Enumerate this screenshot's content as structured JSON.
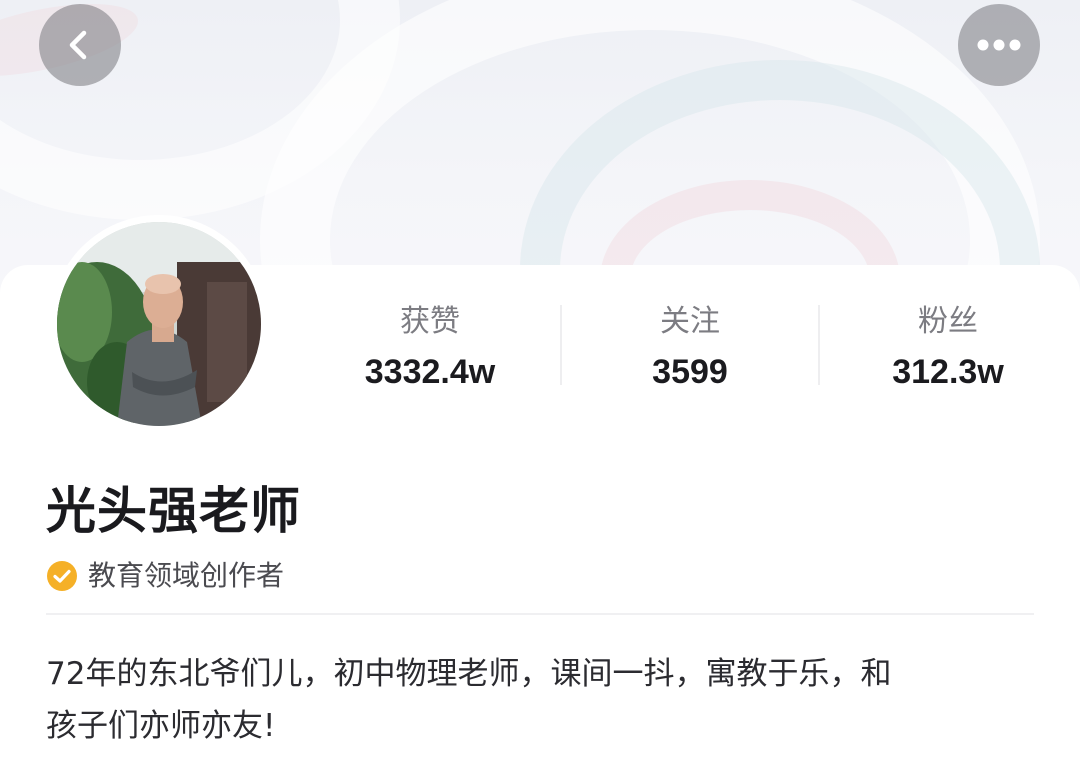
{
  "header": {
    "back_icon": "chevron-left-icon",
    "more_icon": "more-horizontal-icon"
  },
  "profile": {
    "name": "光头强老师",
    "verification": {
      "icon": "verified-check-icon",
      "text": "教育领域创作者",
      "color": "#F5B027"
    },
    "bio_line1": "72年的东北爷们儿，初中物理老师，课间一抖，寓教于乐，和",
    "bio_line2": "孩子们亦师亦友!"
  },
  "stats": {
    "likes": {
      "label": "获赞",
      "value": "3332.4w"
    },
    "following": {
      "label": "关注",
      "value": "3599"
    },
    "followers": {
      "label": "粉丝",
      "value": "312.3w"
    }
  }
}
